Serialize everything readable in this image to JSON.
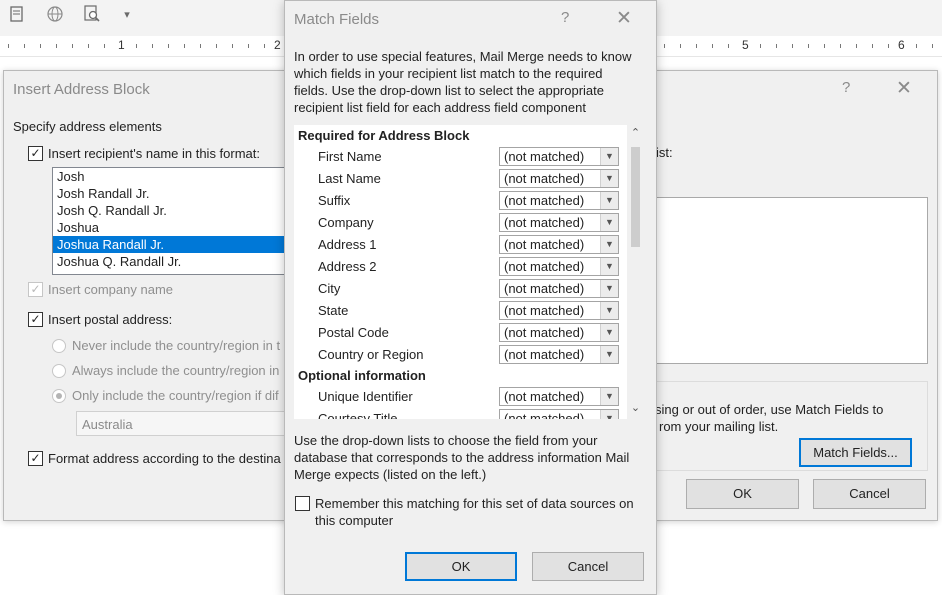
{
  "ruler": {
    "numbers": [
      "1",
      "2",
      "5",
      "6"
    ]
  },
  "toolbar": {
    "icons": [
      "document-icon",
      "globe-icon",
      "preview-magnifier-icon",
      "customize-dropdown-icon"
    ],
    "dropdown_glyph": "▾"
  },
  "insert_address_block": {
    "title": "Insert Address Block",
    "help": "?",
    "close": "✕",
    "specify_label": "Specify address elements",
    "insert_name_label": "Insert recipient's name in this format:",
    "name_formats": [
      "Josh",
      "Josh Randall Jr.",
      "Josh Q. Randall Jr.",
      "Joshua",
      "Joshua Randall Jr.",
      "Joshua Q. Randall Jr."
    ],
    "selected_format": "Joshua Randall Jr.",
    "insert_company_label": "Insert company name",
    "insert_postal_label": "Insert postal address:",
    "radio_never": "Never include the country/region in t",
    "radio_always": "Always include the country/region in",
    "radio_only": "Only include the country/region if dif",
    "country_value": "Australia",
    "format_label": "Format address according to the destina",
    "list_label_partial": "ist:",
    "match_info_line1": "sing or out of order, use Match Fields to",
    "match_info_line2": "rom your mailing list.",
    "match_fields_button": "Match Fields...",
    "ok_button": "OK",
    "cancel_button": "Cancel"
  },
  "match_fields": {
    "title": "Match Fields",
    "help": "?",
    "close": "✕",
    "intro": [
      "In order to use special features, Mail Merge needs to know",
      "which fields in your recipient list match to the required",
      "fields.  Use the drop-down list to select the appropriate",
      "recipient list field for each address field component"
    ],
    "required_header": "Required for Address Block",
    "required_fields": [
      {
        "label": "First Name",
        "value": "(not matched)"
      },
      {
        "label": "Last Name",
        "value": "(not matched)"
      },
      {
        "label": "Suffix",
        "value": "(not matched)"
      },
      {
        "label": "Company",
        "value": "(not matched)"
      },
      {
        "label": "Address 1",
        "value": "(not matched)"
      },
      {
        "label": "Address 2",
        "value": "(not matched)"
      },
      {
        "label": "City",
        "value": "(not matched)"
      },
      {
        "label": "State",
        "value": "(not matched)"
      },
      {
        "label": "Postal Code",
        "value": "(not matched)"
      },
      {
        "label": "Country or Region",
        "value": "(not matched)"
      }
    ],
    "optional_header": "Optional information",
    "optional_fields": [
      {
        "label": "Unique Identifier",
        "value": "(not matched)"
      },
      {
        "label": "Courtesy Title",
        "value": "(not matched)"
      }
    ],
    "help_text": [
      "Use the drop-down lists to choose the field from your",
      "database that corresponds to the address information Mail",
      "Merge expects (listed on the left.)"
    ],
    "remember_label": [
      "Remember this matching for this set of data sources on",
      "this computer"
    ],
    "ok_button": "OK",
    "cancel_button": "Cancel"
  }
}
